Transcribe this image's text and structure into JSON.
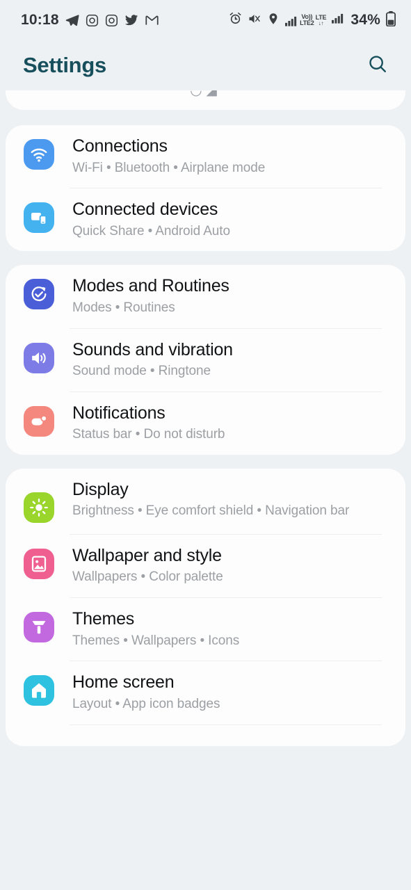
{
  "status_bar": {
    "time": "10:18",
    "left_icons": [
      "telegram-icon",
      "instagram-icon",
      "instagram-icon",
      "twitter-icon",
      "gmail-icon"
    ],
    "right_icons": [
      "alarm-icon",
      "vibrate-mute-icon",
      "location-icon",
      "signal-icon",
      "signal-icon"
    ],
    "volte_label": "Vo))",
    "lte2_label": "LTE2",
    "lte_label": "LTE",
    "data_arrows": "↓↑",
    "battery_percent": "34%"
  },
  "header": {
    "title": "Settings",
    "search_icon": "search-icon"
  },
  "sections": [
    {
      "id": "clipped-card",
      "clipped": true,
      "items": []
    },
    {
      "id": "connections-card",
      "items": [
        {
          "title": "Connections",
          "subtitle": "Wi-Fi  •  Bluetooth  •  Airplane mode",
          "icon": "wifi-icon",
          "color": "#4c9af0"
        },
        {
          "title": "Connected devices",
          "subtitle": "Quick Share  •  Android Auto",
          "icon": "connected-devices-icon",
          "color": "#43b2ef"
        }
      ]
    },
    {
      "id": "modes-sounds-card",
      "items": [
        {
          "title": "Modes and Routines",
          "subtitle": "Modes  •  Routines",
          "icon": "modes-routines-icon",
          "color": "#4a5ed8"
        },
        {
          "title": "Sounds and vibration",
          "subtitle": "Sound mode  •  Ringtone",
          "icon": "sound-speaker-icon",
          "color": "#7d7ce6"
        },
        {
          "title": "Notifications",
          "subtitle": "Status bar  •  Do not disturb",
          "icon": "notifications-icon",
          "color": "#f4887e"
        }
      ]
    },
    {
      "id": "display-card",
      "items": [
        {
          "title": "Display",
          "subtitle": "Brightness  •  Eye comfort shield  •  Navigation bar",
          "icon": "brightness-sun-icon",
          "color": "#9ad52b"
        },
        {
          "title": "Wallpaper and style",
          "subtitle": "Wallpapers  •  Color palette",
          "icon": "wallpaper-image-icon",
          "color": "#ef5f8f"
        },
        {
          "title": "Themes",
          "subtitle": "Themes  •  Wallpapers  •  Icons",
          "icon": "themes-brush-icon",
          "color": "#c369e0"
        },
        {
          "title": "Home screen",
          "subtitle": "Layout  •  App icon badges",
          "icon": "home-screen-icon",
          "color": "#2ec2e0"
        }
      ]
    }
  ],
  "colors": {
    "background": "#eef1f3",
    "card": "#fdfdfd",
    "title_text": "#111315",
    "subtitle_text": "#9c9fa3",
    "accent": "#17505c",
    "divider": "#eceef0"
  }
}
